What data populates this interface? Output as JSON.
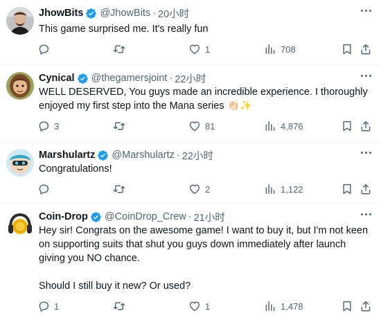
{
  "tweets": [
    {
      "name": "JhowBits",
      "handle": "@JhowBits",
      "dot": "·",
      "time": "20小时",
      "text": "This game surprised me. It's really fun",
      "replies": "",
      "retweets": "",
      "likes": "1",
      "views": "708"
    },
    {
      "name": "Cynical",
      "handle": "@thegamersjoint",
      "dot": "·",
      "time": "22小时",
      "text": "WELL DESERVED, You guys made an incredible experience. I thoroughly enjoyed my first step into the Mana series 👏🏻✨",
      "replies": "3",
      "retweets": "",
      "likes": "81",
      "views": "4,876"
    },
    {
      "name": "Marshulartz",
      "handle": "@Marshulartz",
      "dot": "·",
      "time": "22小时",
      "text": "Congratulations!",
      "replies": "",
      "retweets": "",
      "likes": "2",
      "views": "1,122"
    },
    {
      "name": "Coin-Drop",
      "handle": "@CoinDrop_Crew",
      "dot": "·",
      "time": "21小时",
      "text": "Hey sir! Congrats on the awesome game! I want to buy it, but I'm not keen on supporting suits that shut you guys down immediately after launch giving you NO chance.\n\nShould I still buy it new? Or used?",
      "replies": "1",
      "retweets": "",
      "likes": "1",
      "views": "1,478"
    }
  ],
  "colors": {
    "verified": "#1d9bf0",
    "muted": "#536471",
    "text": "#0f1419"
  },
  "icons": [
    "more-icon",
    "verified-icon",
    "reply-icon",
    "retweet-icon",
    "like-icon",
    "views-icon",
    "bookmark-icon",
    "share-icon"
  ]
}
